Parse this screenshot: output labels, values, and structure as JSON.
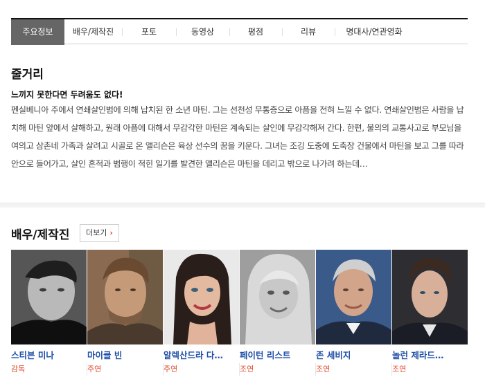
{
  "tabs": [
    "주요정보",
    "배우/제작진",
    "포토",
    "동영상",
    "평점",
    "리뷰",
    "명대사/연관영화"
  ],
  "summary": {
    "heading": "줄거리",
    "tagline": "느끼지 못한다면 두려움도 없다!",
    "text": "펜실베니아 주에서 연쇄살인범에 의해 납치된 한 소년 마틴. 그는 선천성 무통증으로 아픔을 전혀 느낄 수 없다. 연쇄살인범은 사람을 납치해 마틴 앞에서 살해하고, 원래 아픔에 대해서 무감각한 마틴은 계속되는 살인에 무감각해져 간다. 한편, 불의의 교통사고로 부모님을 여의고 삼촌네 가족과 살려고 시골로 온 앨리슨은 육상 선수의 꿈을 키운다. 그녀는 조깅 도중에 도축장 건물에서 마틴을 보고 그를 따라 안으로 들어가고, 살인 흔적과 범행이 적힌 일기를 발견한 앨리슨은 마틴을 데리고 밖으로 나가려 하는데…"
  },
  "cast_section": {
    "heading": "배우/제작진",
    "more_label": "더보기",
    "more_icon": "chevron-right-icon",
    "people": [
      {
        "name": "스티븐 미나",
        "role": "감독"
      },
      {
        "name": "마이클 빈",
        "role": "주연"
      },
      {
        "name": "알렉산드라 다…",
        "role": "주연"
      },
      {
        "name": "페이턴 리스트",
        "role": "조연"
      },
      {
        "name": "존 세비지",
        "role": "조연"
      },
      {
        "name": "놀런 제라드…",
        "role": "조연"
      }
    ]
  },
  "colors": {
    "accent_blue": "#1f4fa8",
    "role_red": "#e04a2f",
    "active_tab": "#666666"
  }
}
